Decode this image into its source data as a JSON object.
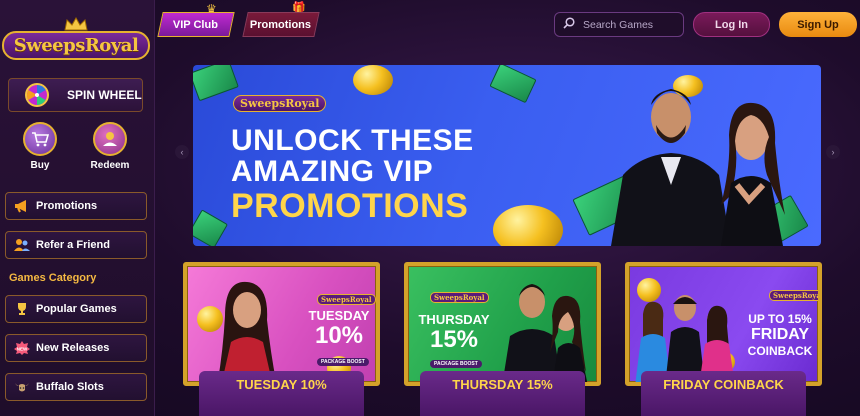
{
  "brand": {
    "name": "SweepsRoyal"
  },
  "sidebar": {
    "spin_wheel": "SPIN WHEEL",
    "buy": "Buy",
    "redeem": "Redeem",
    "promotions": "Promotions",
    "refer": "Refer a Friend",
    "games_category": "Games Category",
    "popular": "Popular Games",
    "new_releases": "New Releases",
    "buffalo": "Buffalo Slots"
  },
  "header": {
    "vip_club": "VIP Club",
    "promotions": "Promotions",
    "search_placeholder": "Search Games",
    "login": "Log In",
    "signup": "Sign Up"
  },
  "banner": {
    "logo": "SweepsRoyal",
    "line1": "UNLOCK THESE",
    "line2": "AMAZING VIP",
    "line3": "PROMOTIONS"
  },
  "cards": [
    {
      "logo": "SweepsRoyal",
      "headline": "TUESDAY",
      "big": "10%",
      "pill": "PACKAGE BOOST",
      "label": "TUESDAY 10%"
    },
    {
      "logo": "SweepsRoyal",
      "headline": "THURSDAY",
      "big": "15%",
      "pill": "PACKAGE BOOST",
      "label": "THURSDAY 15%"
    },
    {
      "logo": "SweepsRoyal",
      "headline": "UP TO 15%",
      "big": "FRIDAY",
      "sub": "COINBACK",
      "label": "FRIDAY COINBACK"
    }
  ],
  "colors": {
    "accent": "#f5c542",
    "signup": "#ffb23a",
    "banner_bg": "#3a5ef0"
  }
}
